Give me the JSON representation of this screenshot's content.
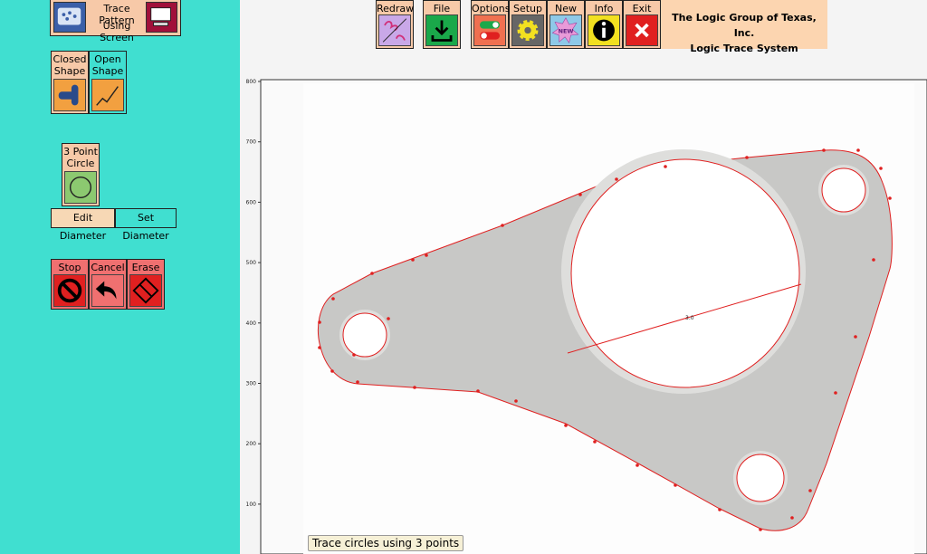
{
  "sidebar": {
    "trace": {
      "label_line1": "Trace Pattern",
      "label_line2": "Using Screen"
    },
    "closed_shape": {
      "label_line1": "Closed",
      "label_line2": "Shape"
    },
    "open_shape": {
      "label_line1": "Open",
      "label_line2": "Shape"
    },
    "circle3": {
      "label_line1": "3 Point",
      "label_line2": "Circle"
    },
    "edit_diameter": "Edit Diameter",
    "set_diameter": "Set Diameter",
    "stop": "Stop",
    "cancel": "Cancel",
    "erase": "Erase"
  },
  "toolbar": {
    "redraw": "Redraw",
    "file": "File",
    "options": "Options",
    "setup": "Setup",
    "new": "New",
    "new_badge": "NEW",
    "info": "Info",
    "exit": "Exit"
  },
  "brand": {
    "line1": "The Logic Group of Texas, Inc.",
    "line2": "Logic Trace System"
  },
  "plot": {
    "y_ticks": [
      "800",
      "700",
      "600",
      "500",
      "400",
      "300",
      "200",
      "100"
    ],
    "diameter_label": "3.0"
  },
  "status": "Trace circles using 3 points",
  "colors": {
    "sidebar": "#40dfd0",
    "trace_line": "#e02020",
    "button_peach": "#f7c9a8"
  }
}
